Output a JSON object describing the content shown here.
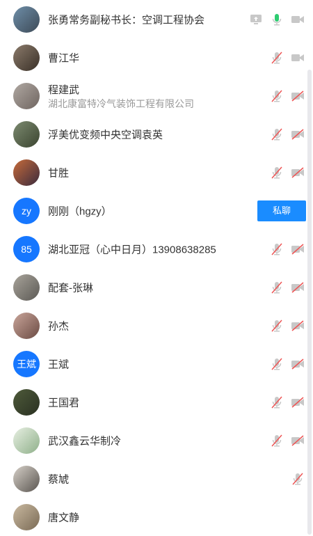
{
  "participants": [
    {
      "name": "张勇常务副秘书长：空调工程协会",
      "avatar_type": "photo",
      "icons": [
        "share-screen-icon",
        "mic-active-icon",
        "video-icon"
      ]
    },
    {
      "name": "曹江华",
      "avatar_type": "photo",
      "icons": [
        "mic-off-icon",
        "video-icon"
      ]
    },
    {
      "name": "程建武",
      "subtitle": "湖北康富特冷气装饰工程有限公司",
      "avatar_type": "photo",
      "icons": [
        "mic-off-icon",
        "video-off-icon"
      ]
    },
    {
      "name": "浮美优变频中央空调袁英",
      "avatar_type": "photo",
      "icons": [
        "mic-off-icon",
        "video-off-icon"
      ]
    },
    {
      "name": "甘胜",
      "avatar_type": "photo",
      "icons": [
        "mic-off-icon",
        "video-off-icon"
      ]
    },
    {
      "name": "刚刚（hgzy）",
      "avatar_type": "text",
      "avatar_text": "zy",
      "button": "私聊"
    },
    {
      "name": "湖北亚冠（心中日月）13908638285",
      "avatar_type": "text",
      "avatar_text": "85",
      "icons": [
        "mic-off-icon",
        "video-off-icon"
      ]
    },
    {
      "name": "配套-张琳",
      "avatar_type": "photo",
      "icons": [
        "mic-off-icon",
        "video-off-icon"
      ]
    },
    {
      "name": "孙杰",
      "avatar_type": "photo",
      "icons": [
        "mic-off-icon",
        "video-off-icon"
      ]
    },
    {
      "name": "王斌",
      "avatar_type": "text",
      "avatar_text": "王斌",
      "icons": [
        "mic-off-icon",
        "video-off-icon"
      ]
    },
    {
      "name": "王国君",
      "avatar_type": "photo",
      "icons": [
        "mic-off-icon",
        "video-off-icon"
      ]
    },
    {
      "name": "武汉鑫云华制冷",
      "avatar_type": "photo",
      "icons": [
        "mic-off-icon",
        "video-off-icon"
      ]
    },
    {
      "name": "蔡虓",
      "avatar_type": "photo",
      "icons": [
        "mic-off-icon"
      ]
    },
    {
      "name": "唐文静",
      "avatar_type": "photo",
      "icons": []
    }
  ],
  "colors": {
    "accent": "#1677ff",
    "mic_active": "#2ecc71",
    "icon_gray": "#c8c8c8",
    "slash_red": "#e55"
  }
}
